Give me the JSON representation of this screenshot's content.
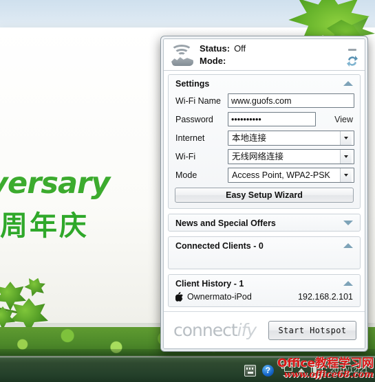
{
  "desktop": {
    "wallpaper_text_en": "versary",
    "wallpaper_text_cn": "周年庆"
  },
  "taskbar": {
    "icons": [
      {
        "name": "keyboard-ime-icon",
        "glyph": ""
      },
      {
        "name": "help-icon",
        "glyph": "?"
      },
      {
        "name": "window-switch-icon",
        "glyph": ""
      },
      {
        "name": "show-hidden-icons-icon",
        "glyph": ""
      },
      {
        "name": "network-monitor-icon",
        "glyph": ""
      }
    ],
    "clock": "2010/12/21",
    "watermark_line1": "Office教程学习网",
    "watermark_line2": "www.office68.com",
    "watermark_color": "#d81919"
  },
  "window": {
    "header": {
      "status_label": "Status:",
      "status_value": "Off",
      "mode_label": "Mode:",
      "mode_value": "",
      "minimize_title": "minimize",
      "refresh_title": "refresh"
    },
    "settings": {
      "title": "Settings",
      "collapse_state": "expanded",
      "rows": [
        {
          "label": "Wi-Fi Name",
          "type": "text",
          "value": "www.guofs.com",
          "extra": ""
        },
        {
          "label": "Password",
          "type": "password",
          "value": "••••••••••",
          "extra": "View"
        },
        {
          "label": "Internet",
          "type": "select",
          "value": "本地连接",
          "extra": ""
        },
        {
          "label": "Wi-Fi",
          "type": "select",
          "value": "无线网络连接",
          "extra": ""
        },
        {
          "label": "Mode",
          "type": "select",
          "value": "Access Point, WPA2-PSK",
          "extra": ""
        }
      ],
      "wizard_button": "Easy Setup Wizard"
    },
    "news": {
      "title": "News and Special Offers",
      "collapse_state": "collapsed"
    },
    "connected_clients": {
      "title": "Connected Clients - 0",
      "collapse_state": "expanded",
      "clients": []
    },
    "client_history": {
      "title": "Client History - 1",
      "collapse_state": "expanded",
      "clients": [
        {
          "icon": "apple-icon",
          "name": "Ownermato-iPod",
          "ip": "192.168.2.101"
        }
      ]
    },
    "footer": {
      "brand_head": "connect",
      "brand_tail": "ify",
      "start_button": "Start Hotspot"
    }
  },
  "colors": {
    "accent_chevron": "#7ea3b8",
    "wallpaper_green": "#2fa82a",
    "watermark_red": "#d81919"
  }
}
